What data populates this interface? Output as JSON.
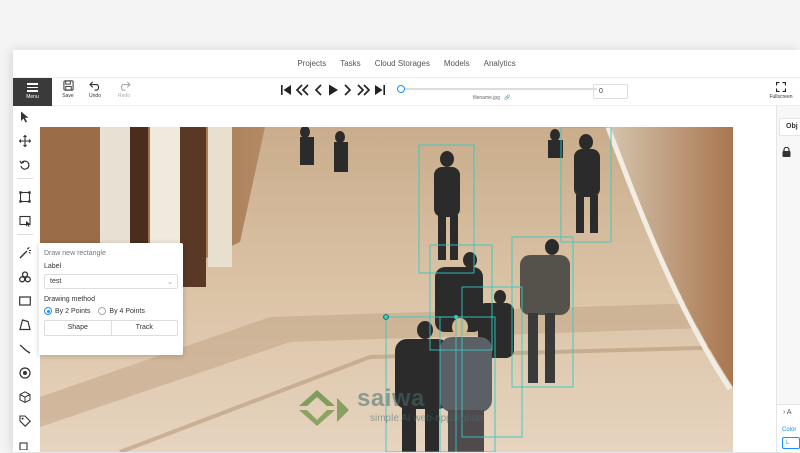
{
  "nav": {
    "items": [
      "Projects",
      "Tasks",
      "Cloud Storages",
      "Models",
      "Analytics"
    ]
  },
  "toolbar": {
    "menu_label": "Menu",
    "save_label": "Save",
    "undo_label": "Undo",
    "redo_label": "Redo",
    "filename": "filename.jpg",
    "frame_value": "0",
    "fullscreen_label": "Fullscreen"
  },
  "popup": {
    "title": "Draw new rectangle",
    "label_caption": "Label",
    "label_value": "test",
    "method_caption": "Drawing method",
    "option_2": "By 2 Points",
    "option_4": "By 4 Points",
    "selected_option": "By 2 Points",
    "shape_button": "Shape",
    "track_button": "Track"
  },
  "right_panel": {
    "tab_label": "Obj",
    "collapse_label": "A",
    "color_label": "Color",
    "color_box": "L"
  },
  "watermark": {
    "brand": "saiwa",
    "tagline": "simple AI web-application"
  },
  "colors": {
    "bbox": "#33c9c4",
    "accent": "#1890ff",
    "menu_bg": "#3a3a3a"
  },
  "icons": {
    "sidebar": [
      "cursor-icon",
      "move-icon",
      "rotate-icon",
      "fit-image-icon",
      "select-region-icon",
      "magic-wand-icon",
      "openvino-icon",
      "rectangle-icon",
      "polygon-icon",
      "polyline-icon",
      "points-icon",
      "cuboid-icon",
      "tag-icon"
    ]
  }
}
